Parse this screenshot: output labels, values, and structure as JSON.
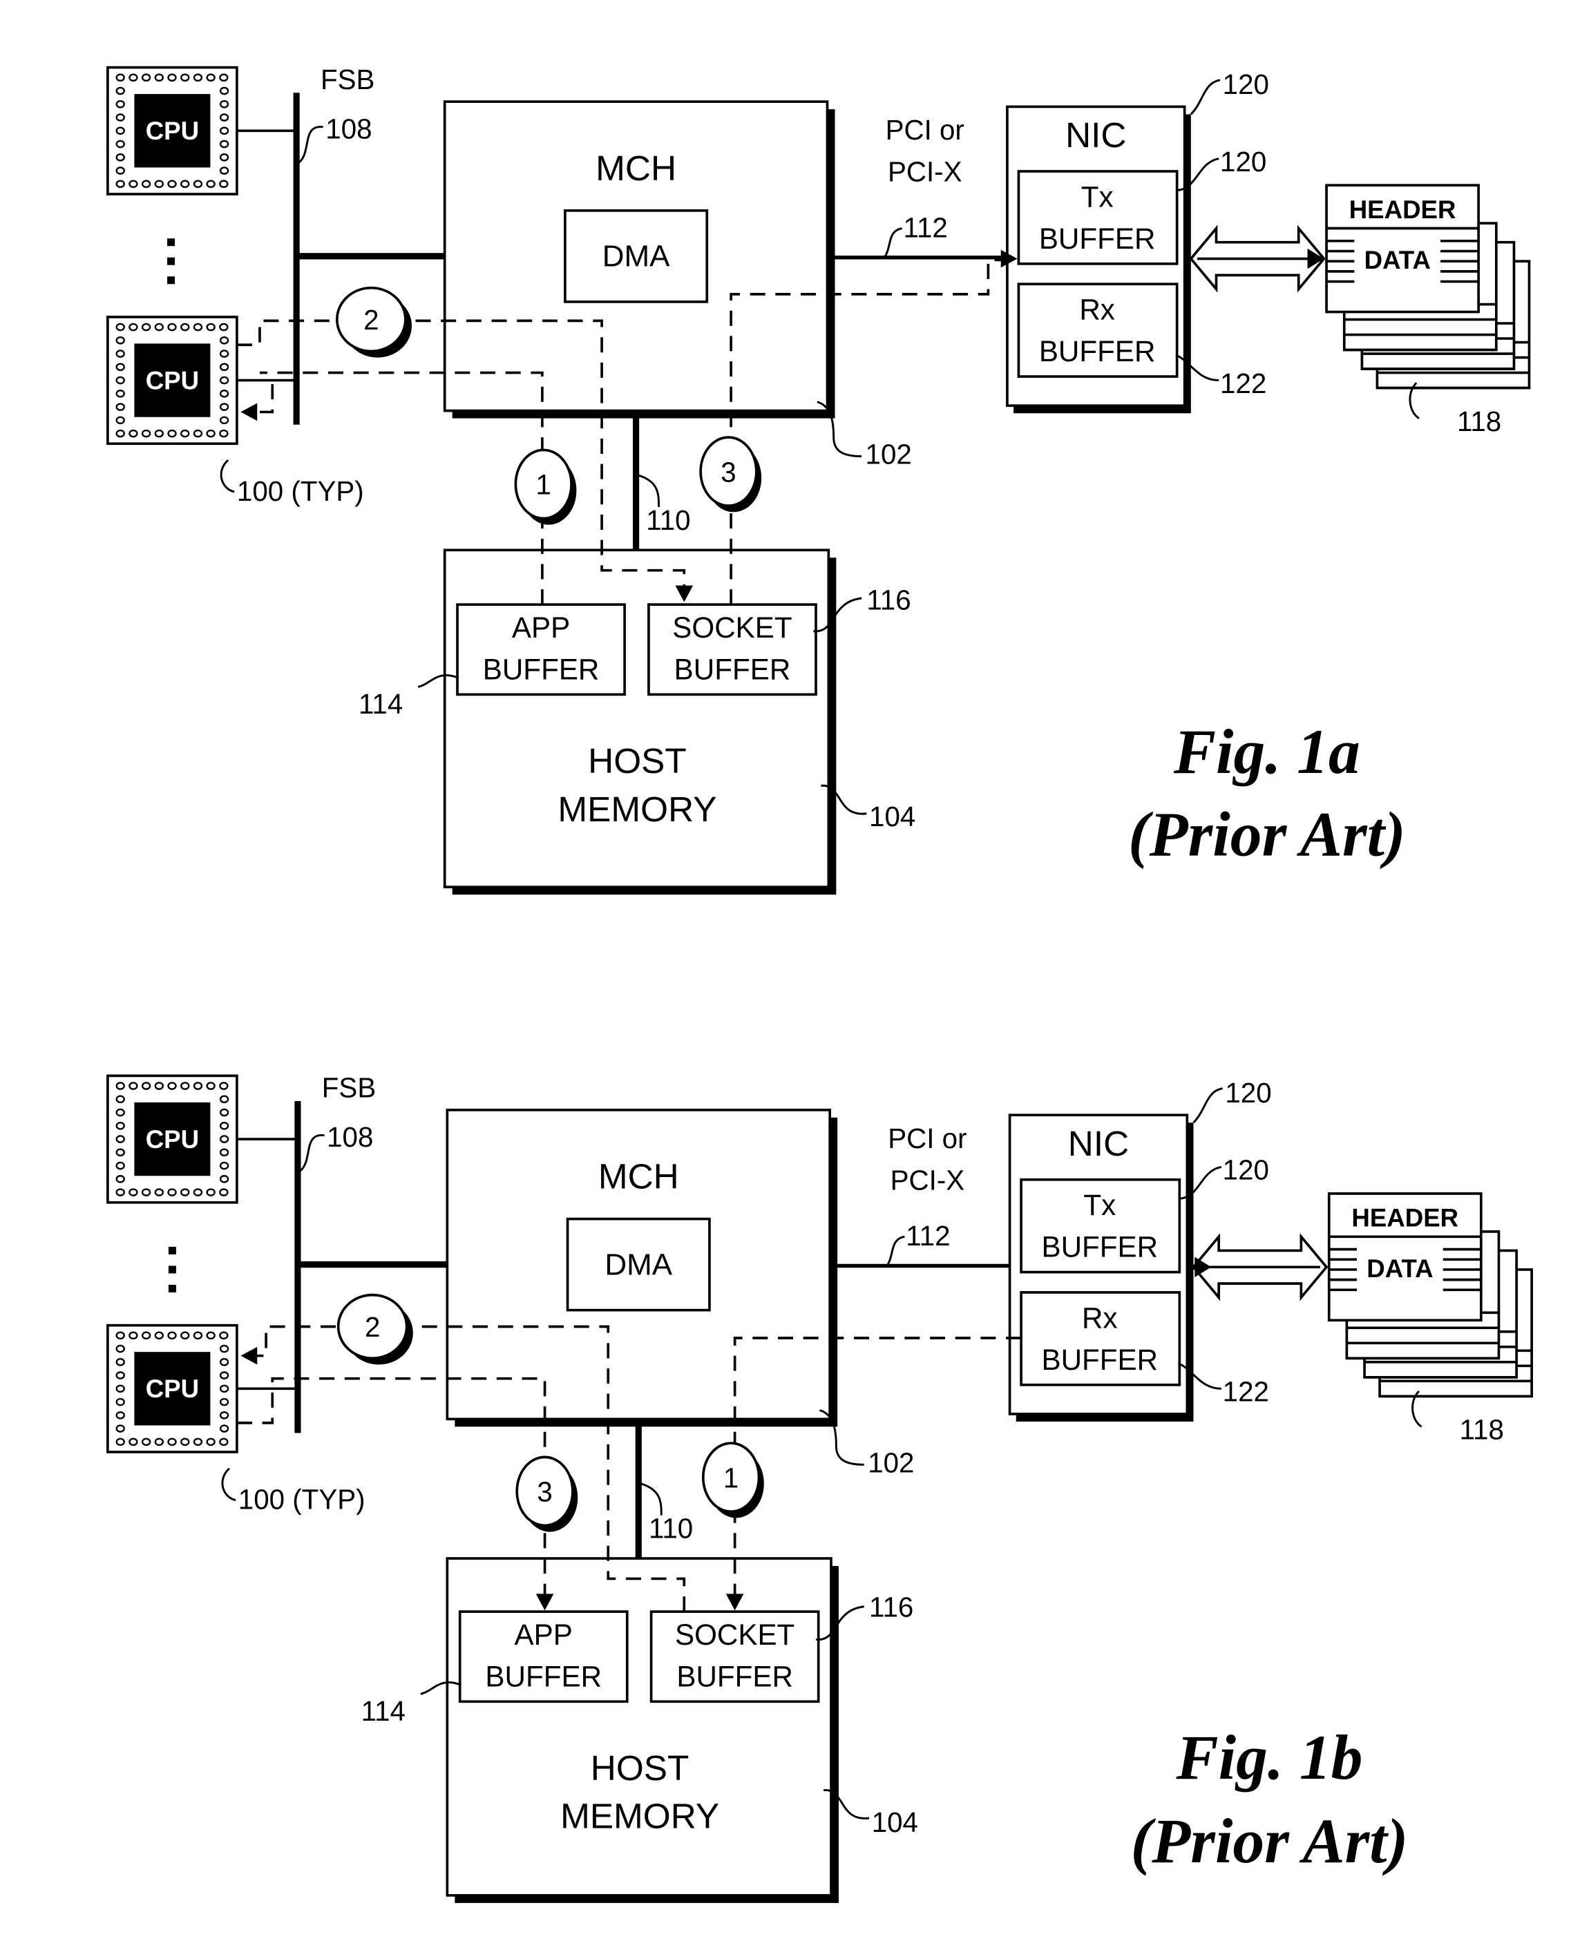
{
  "figures": [
    {
      "id": "fig1a",
      "caption": [
        "Fig. 1a",
        "(Prior Art)"
      ],
      "cpu_label": "CPU",
      "fsb": {
        "label": "FSB",
        "ref": "108"
      },
      "cpu_ref": "100 (TYP)",
      "mch": {
        "label": "MCH",
        "dma": "DMA",
        "ref": "102"
      },
      "link": {
        "label": [
          "PCI or",
          "PCI-X"
        ],
        "ref": "112"
      },
      "nic": {
        "label": "NIC",
        "ref": "120",
        "tx": [
          "Tx",
          "BUFFER"
        ],
        "tx_ref": "120",
        "rx": [
          "Rx",
          "BUFFER"
        ],
        "rx_ref": "122"
      },
      "memory_bus_ref": "110",
      "host_memory": {
        "label": [
          "HOST",
          "MEMORY"
        ],
        "ref": "104",
        "app": [
          "APP",
          "BUFFER"
        ],
        "app_ref": "114",
        "socket": [
          "SOCKET",
          "BUFFER"
        ],
        "socket_ref": "116"
      },
      "packets": {
        "header": "HEADER",
        "data": "DATA",
        "ref": "118"
      },
      "steps": [
        "1",
        "2",
        "3"
      ]
    },
    {
      "id": "fig1b",
      "caption": [
        "Fig. 1b",
        "(Prior Art)"
      ],
      "cpu_label": "CPU",
      "fsb": {
        "label": "FSB",
        "ref": "108"
      },
      "cpu_ref": "100 (TYP)",
      "mch": {
        "label": "MCH",
        "dma": "DMA",
        "ref": "102"
      },
      "link": {
        "label": [
          "PCI or",
          "PCI-X"
        ],
        "ref": "112"
      },
      "nic": {
        "label": "NIC",
        "ref": "120",
        "tx": [
          "Tx",
          "BUFFER"
        ],
        "tx_ref": "120",
        "rx": [
          "Rx",
          "BUFFER"
        ],
        "rx_ref": "122"
      },
      "memory_bus_ref": "110",
      "host_memory": {
        "label": [
          "HOST",
          "MEMORY"
        ],
        "ref": "104",
        "app": [
          "APP",
          "BUFFER"
        ],
        "app_ref": "114",
        "socket": [
          "SOCKET",
          "BUFFER"
        ],
        "socket_ref": "116"
      },
      "packets": {
        "header": "HEADER",
        "data": "DATA",
        "ref": "118"
      },
      "steps": [
        "1",
        "2",
        "3"
      ]
    }
  ]
}
